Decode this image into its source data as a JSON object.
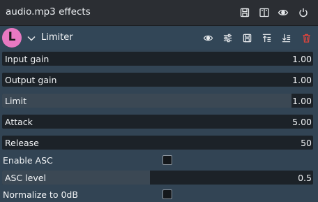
{
  "window": {
    "title": "audio.mp3 effects",
    "toolbar_icons": [
      "save-preset-icon",
      "split-view-icon",
      "eye-icon",
      "power-icon"
    ]
  },
  "effect": {
    "avatar_letter": "L",
    "avatar_color": "#e879c2",
    "name": "Limiter",
    "header_icons": [
      "eye-icon",
      "settings-sliders-icon",
      "save-icon",
      "move-up-icon",
      "move-down-icon",
      "delete-icon"
    ],
    "delete_color": "#e0453c"
  },
  "params": {
    "input_gain": {
      "label": "Input gain",
      "value": "1.00",
      "fraction": 0.0
    },
    "output_gain": {
      "label": "Output gain",
      "value": "1.00",
      "fraction": 0.0
    },
    "limit": {
      "label": "Limit",
      "value": "1.00",
      "fraction": 0.93
    },
    "attack": {
      "label": "Attack",
      "value": "5.00",
      "fraction": 0.0
    },
    "release": {
      "label": "Release",
      "value": "50",
      "fraction": 0.0
    },
    "enable_asc": {
      "label": "Enable ASC",
      "checked": false
    },
    "asc_level": {
      "label": "ASC level",
      "value": "0.5",
      "fraction": 0.475
    },
    "normalize": {
      "label": "Normalize to 0dB",
      "checked": false
    }
  }
}
